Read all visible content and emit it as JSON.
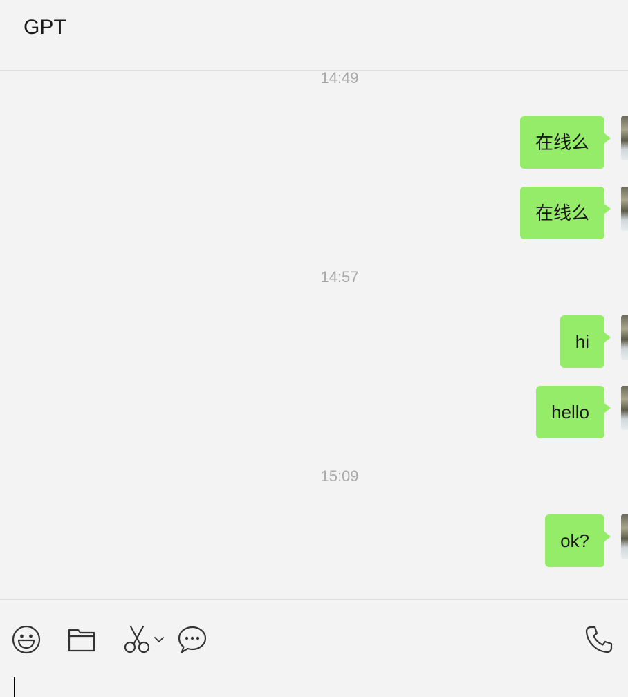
{
  "header": {
    "title": "GPT"
  },
  "messages": [
    {
      "type": "timestamp",
      "text": "14:49"
    },
    {
      "type": "outgoing",
      "text": "在线么"
    },
    {
      "type": "outgoing",
      "text": "在线么"
    },
    {
      "type": "timestamp",
      "text": "14:57"
    },
    {
      "type": "outgoing",
      "text": "hi"
    },
    {
      "type": "outgoing",
      "text": "hello"
    },
    {
      "type": "timestamp",
      "text": "15:09"
    },
    {
      "type": "outgoing",
      "text": "ok?"
    }
  ],
  "toolbar": {
    "icons": [
      "emoji-icon",
      "folder-icon",
      "scissors-icon",
      "chevron-down-icon",
      "chat-bubble-icon",
      "phone-icon"
    ]
  },
  "composer": {
    "value": ""
  },
  "colors": {
    "background": "#f3f3f3",
    "bubble_outgoing": "#95ec69",
    "timestamp": "#a9a9a9",
    "text": "#1a1a1a"
  }
}
